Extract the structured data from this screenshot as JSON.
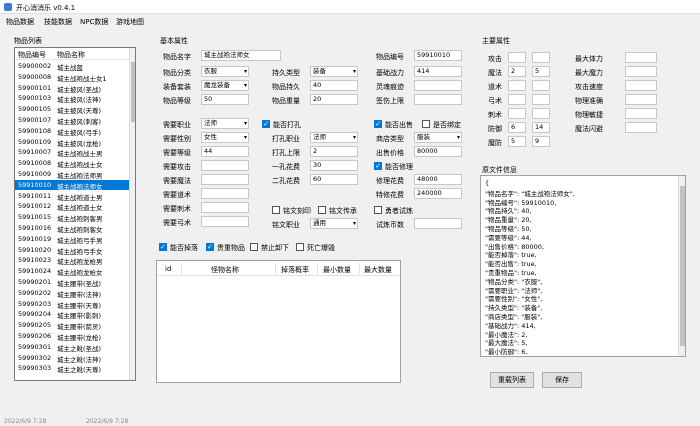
{
  "window": {
    "title": "开心消消乐 v0.4.1"
  },
  "menu": [
    "物品数据",
    "技能数据",
    "NPC数据",
    "游戏地图"
  ],
  "item_list": {
    "title": "物品列表",
    "col_id": "物品编号",
    "col_name": "物品名称",
    "rows": [
      {
        "id": "59900002",
        "name": "城主战盔"
      },
      {
        "id": "59900008",
        "name": "城主战袍战士女1"
      },
      {
        "id": "59900101",
        "name": "城主披风(圣战)"
      },
      {
        "id": "59900103",
        "name": "城主披风(法神)"
      },
      {
        "id": "59900105",
        "name": "城主披风(天尊)"
      },
      {
        "id": "59900107",
        "name": "城主披风(刺客)"
      },
      {
        "id": "59900108",
        "name": "城主披风(弓手)"
      },
      {
        "id": "59900109",
        "name": "城主披风(龙枪)"
      },
      {
        "id": "59910007",
        "name": "城主战袍战士男"
      },
      {
        "id": "59910008",
        "name": "城主战袍战士女"
      },
      {
        "id": "59910009",
        "name": "城主战袍法师男"
      },
      {
        "id": "59910010",
        "name": "城主战袍法师女"
      },
      {
        "id": "59910011",
        "name": "城主战袍道士男"
      },
      {
        "id": "59910012",
        "name": "城主战袍道士女"
      },
      {
        "id": "59910015",
        "name": "城主战袍刺客男"
      },
      {
        "id": "59910016",
        "name": "城主战袍刺客女"
      },
      {
        "id": "59910019",
        "name": "城主战袍弓手男"
      },
      {
        "id": "59910020",
        "name": "城主战袍弓手女"
      },
      {
        "id": "59910023",
        "name": "城主战袍龙枪男"
      },
      {
        "id": "59910024",
        "name": "城主战袍龙枪女"
      },
      {
        "id": "59990201",
        "name": "城主腰带(圣战)"
      },
      {
        "id": "59990202",
        "name": "城主腰带(法神)"
      },
      {
        "id": "59990203",
        "name": "城主腰带(天尊)"
      },
      {
        "id": "59990204",
        "name": "城主腰带(影刺)"
      },
      {
        "id": "59990205",
        "name": "城主腰带(箭灵)"
      },
      {
        "id": "59990206",
        "name": "城主腰带(龙枪)"
      },
      {
        "id": "59990301",
        "name": "城主之靴(圣战)"
      },
      {
        "id": "59990302",
        "name": "城主之靴(法神)"
      },
      {
        "id": "59990303",
        "name": "城主之靴(天尊)"
      }
    ],
    "selected_index": 11
  },
  "basic": {
    "title": "基本属性",
    "name_label": "物品名字",
    "name_value": "城主战袍法师女",
    "class_label": "物品分类",
    "class_value": "衣服",
    "durability_type_label": "持久类型",
    "durability_type_value": "装备",
    "set_label": "装备套装",
    "set_value": "魔龙装备",
    "durability_label": "物品持久",
    "durability_value": "40",
    "level_label": "物品等级",
    "level_value": "50",
    "weight_label": "物品重量",
    "weight_value": "20",
    "id_label": "物品编号",
    "id_value": "59910010",
    "power_label": "基础战力",
    "power_value": "414",
    "soul_label": "灵魂痕迹",
    "soul_value": "",
    "spirit_label": "签伤上限",
    "spirit_value": ""
  },
  "requirements": {
    "job_label": "需要职业",
    "job_value": "法师",
    "gender_label": "需要性别",
    "gender_value": "女性",
    "level_label": "需要等级",
    "level_value": "44",
    "attack_label": "需要攻击",
    "attack_value": "",
    "magic_label": "需要魔法",
    "magic_value": "",
    "tao_label": "需要道术",
    "tao_value": "",
    "assassin_label": "需要刺术",
    "assassin_value": "",
    "archer_label": "需要弓术",
    "archer_value": ""
  },
  "hole": {
    "can_punch_label": "能否打孔",
    "can_punch": true,
    "job_label": "打孔职业",
    "job_value": "法师",
    "limit_label": "打孔上限",
    "limit_value": "2",
    "cost1_label": "一孔花费",
    "cost1_value": "30",
    "cost2_label": "二孔花费",
    "cost2_value": "60"
  },
  "shop": {
    "can_sell_label": "能否出售",
    "can_sell": true,
    "bound_label": "是否绑定",
    "bound": false,
    "type_label": "商店类型",
    "type_value": "服装",
    "price_label": "出售价格",
    "price_value": "80000",
    "can_repair_label": "能否修理",
    "can_repair": true,
    "repair_label": "修理花费",
    "repair_value": "48000",
    "special_repair_label": "特修花费",
    "special_repair_value": "240000"
  },
  "inscription": {
    "engrave_label": "铭文刻印",
    "engrave": false,
    "inherit_label": "铭文传承",
    "inherit": false,
    "job_label": "铭文职业",
    "job_value": "通用",
    "trial_label": "勇者试炼",
    "trial": false,
    "trial_coin_label": "试炼币数",
    "trial_coin_value": ""
  },
  "drop": {
    "can_drop_label": "能否掉落",
    "can_drop": true,
    "valuable_label": "贵重物品",
    "valuable": true,
    "no_unequip_label": "禁止卸下",
    "no_unequip": false,
    "death_drop_label": "死亡爆毁",
    "death_drop": false,
    "columns": [
      "id",
      "怪物名称",
      "掉落概率",
      "最小数量",
      "最大数量"
    ]
  },
  "main_attr": {
    "title": "主要属性",
    "attack_label": "攻击",
    "attack_min": "",
    "attack_max": "",
    "magic_label": "魔法",
    "magic_min": "2",
    "magic_max": "5",
    "tao_label": "道术",
    "tao_min": "",
    "tao_max": "",
    "bow_label": "弓术",
    "bow_min": "",
    "bow_max": "",
    "stab_label": "刺术",
    "stab_min": "",
    "stab_max": "",
    "def_label": "防御",
    "def_min": "6",
    "def_max": "14",
    "mdef_label": "魔防",
    "mdef_min": "5",
    "mdef_max": "9",
    "maxhp_label": "最大体力",
    "maxhp": "",
    "maxmp_label": "最大魔力",
    "maxmp": "",
    "atkspd_label": "攻击速度",
    "atkspd": "",
    "acc_label": "物理准确",
    "acc": "",
    "agi_label": "物理敏捷",
    "agi": "",
    "mevade_label": "魔法闪避",
    "mevade": ""
  },
  "source": {
    "title": "原文件信息",
    "lines": [
      "{",
      "  \"物品名字\": \"城主战袍法师女\",",
      "  \"物品编号\": 59910010,",
      "  \"物品持久\": 40,",
      "  \"物品重量\": 20,",
      "  \"物品等级\": 50,",
      "  \"需要等级\": 44,",
      "  \"出售价格\": 80000,",
      "  \"能否掉落\": true,",
      "  \"能否出售\": true,",
      "  \"贵重物品\": true,",
      "  \"物品分类\": \"衣服\",",
      "  \"需要职业\": \"法师\",",
      "  \"需要性别\": \"女性\",",
      "  \"持久类型\": \"装备\",",
      "  \"商店类型\": \"服装\",",
      "  \"基础战力\": 414,",
      "  \"最小魔法\": 2,",
      "  \"最大魔法\": 5,",
      "  \"最小防御\": 6,"
    ]
  },
  "buttons": {
    "refresh": "重载列表",
    "save": "保存"
  },
  "status": {
    "left": "2022/6/9 7:28",
    "mid": "2022/6/9 7:28"
  }
}
